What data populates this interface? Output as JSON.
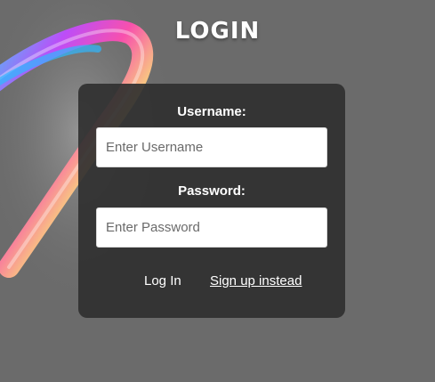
{
  "page": {
    "title": "LOGIN"
  },
  "form": {
    "username_label": "Username:",
    "username_placeholder": "Enter Username",
    "username_value": "",
    "password_label": "Password:",
    "password_placeholder": "Enter Password",
    "password_value": "",
    "login_button": "Log In",
    "signup_link": "Sign up instead"
  },
  "colors": {
    "background": "#6b6b6b",
    "card": "#303030",
    "text": "#ffffff"
  },
  "icons": {
    "decoration": "holographic-swirl-graphic"
  }
}
